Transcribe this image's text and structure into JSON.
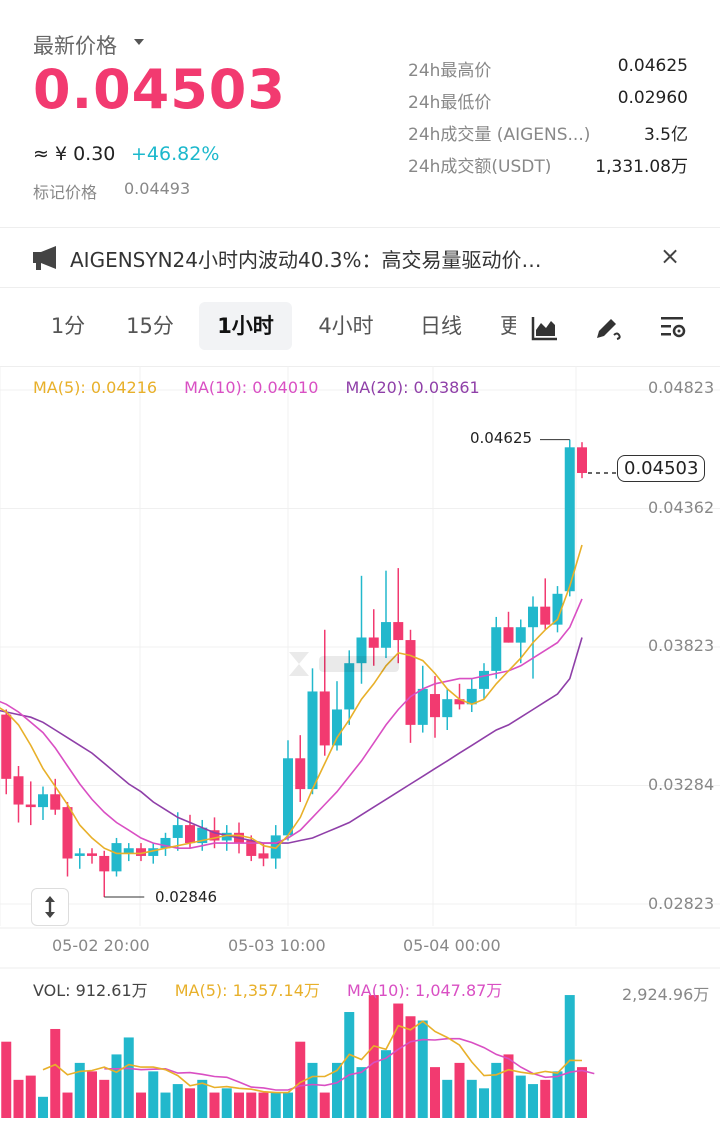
{
  "header": {
    "latest_label": "最新价格",
    "price": "0.04503",
    "cny": "≈ ¥ 0.30",
    "change": "+46.82%",
    "mark_label": "标记价格",
    "mark_value": "0.04493",
    "price_color": "#f23a70",
    "change_color": "#1cb8cc"
  },
  "stats": [
    {
      "label": "24h最高价",
      "value": "0.04625"
    },
    {
      "label": "24h最低价",
      "value": "0.02960"
    },
    {
      "label": "24h成交量 (AIGENS...)",
      "value": "3.5亿"
    },
    {
      "label": "24h成交额(USDT)",
      "value": "1,331.08万"
    }
  ],
  "announcement": {
    "icon": "megaphone-icon",
    "text": "AIGENSYN24小时内波动40.3%：高交易量驱动价…",
    "close": "×"
  },
  "tabs": [
    {
      "label": "1分",
      "active": false
    },
    {
      "label": "15分",
      "active": false
    },
    {
      "label": "1小时",
      "active": true
    },
    {
      "label": "4小时",
      "active": false
    },
    {
      "label": "日线",
      "active": false
    },
    {
      "label": "更",
      "active": false
    }
  ],
  "toolbar_icons": [
    "chart-type-icon",
    "draw-icon",
    "indicator-settings-icon"
  ],
  "chart": {
    "ma_legend": {
      "ma5": "MA(5): 0.04216",
      "ma10": "MA(10): 0.04010",
      "ma20": "MA(20): 0.03861"
    },
    "y_labels": [
      "0.04823",
      "0.04362",
      "0.03823",
      "0.03284",
      "0.02823"
    ],
    "current_price_tag": "0.04503",
    "high_annotation": "0.04625",
    "low_annotation": "0.02846",
    "x_labels": [
      "05-02 20:00",
      "05-03 10:00",
      "05-04 00:00"
    ],
    "vol_legend": {
      "vol": "VOL: 912.61万",
      "ma5": "MA(5): 1,357.14万",
      "ma10": "MA(10): 1,047.87万"
    },
    "vol_max": "2,924.96万",
    "colors": {
      "up": "#22b8cc",
      "down": "#f23a70",
      "ma5": "#e8b02a",
      "ma10": "#d94fc3",
      "ma20": "#8f3fa8"
    }
  },
  "chart_data": {
    "type": "candlestick",
    "interval": "1小时",
    "ylim": [
      0.02823,
      0.04823
    ],
    "candles": [
      {
        "o": 0.0362,
        "h": 0.0368,
        "l": 0.0349,
        "c": 0.0358
      },
      {
        "o": 0.0356,
        "h": 0.0358,
        "l": 0.0325,
        "c": 0.0331
      },
      {
        "o": 0.0332,
        "h": 0.0336,
        "l": 0.0314,
        "c": 0.0321
      },
      {
        "o": 0.0321,
        "h": 0.033,
        "l": 0.0313,
        "c": 0.032
      },
      {
        "o": 0.032,
        "h": 0.0328,
        "l": 0.0315,
        "c": 0.0325
      },
      {
        "o": 0.0325,
        "h": 0.0331,
        "l": 0.0317,
        "c": 0.0319
      },
      {
        "o": 0.032,
        "h": 0.0322,
        "l": 0.0293,
        "c": 0.03
      },
      {
        "o": 0.0301,
        "h": 0.0304,
        "l": 0.0296,
        "c": 0.0302
      },
      {
        "o": 0.0302,
        "h": 0.0304,
        "l": 0.0298,
        "c": 0.0301
      },
      {
        "o": 0.0301,
        "h": 0.0303,
        "l": 0.0285,
        "c": 0.0295
      },
      {
        "o": 0.0295,
        "h": 0.0308,
        "l": 0.0293,
        "c": 0.0306
      },
      {
        "o": 0.0302,
        "h": 0.0306,
        "l": 0.0299,
        "c": 0.0304
      },
      {
        "o": 0.0304,
        "h": 0.0306,
        "l": 0.0299,
        "c": 0.0301
      },
      {
        "o": 0.0301,
        "h": 0.0306,
        "l": 0.0298,
        "c": 0.0304
      },
      {
        "o": 0.0304,
        "h": 0.031,
        "l": 0.0301,
        "c": 0.0308
      },
      {
        "o": 0.0308,
        "h": 0.0318,
        "l": 0.0303,
        "c": 0.0313
      },
      {
        "o": 0.0313,
        "h": 0.0317,
        "l": 0.0304,
        "c": 0.0306
      },
      {
        "o": 0.0306,
        "h": 0.0315,
        "l": 0.0303,
        "c": 0.0312
      },
      {
        "o": 0.0311,
        "h": 0.0316,
        "l": 0.0304,
        "c": 0.0307
      },
      {
        "o": 0.0307,
        "h": 0.0313,
        "l": 0.0303,
        "c": 0.031
      },
      {
        "o": 0.031,
        "h": 0.0314,
        "l": 0.0302,
        "c": 0.0306
      },
      {
        "o": 0.0307,
        "h": 0.0309,
        "l": 0.0299,
        "c": 0.0301
      },
      {
        "o": 0.0302,
        "h": 0.0306,
        "l": 0.0297,
        "c": 0.03
      },
      {
        "o": 0.03,
        "h": 0.0313,
        "l": 0.0296,
        "c": 0.0309
      },
      {
        "o": 0.0309,
        "h": 0.0346,
        "l": 0.0307,
        "c": 0.0339
      },
      {
        "o": 0.0339,
        "h": 0.0348,
        "l": 0.0322,
        "c": 0.0327
      },
      {
        "o": 0.0327,
        "h": 0.0374,
        "l": 0.0325,
        "c": 0.0365
      },
      {
        "o": 0.0365,
        "h": 0.0389,
        "l": 0.034,
        "c": 0.0344
      },
      {
        "o": 0.0344,
        "h": 0.0369,
        "l": 0.0342,
        "c": 0.0358
      },
      {
        "o": 0.0358,
        "h": 0.0381,
        "l": 0.0352,
        "c": 0.0376
      },
      {
        "o": 0.0376,
        "h": 0.041,
        "l": 0.0368,
        "c": 0.0386
      },
      {
        "o": 0.0386,
        "h": 0.0397,
        "l": 0.0375,
        "c": 0.0382
      },
      {
        "o": 0.0382,
        "h": 0.0412,
        "l": 0.0378,
        "c": 0.0392
      },
      {
        "o": 0.0392,
        "h": 0.0413,
        "l": 0.0376,
        "c": 0.0385
      },
      {
        "o": 0.0385,
        "h": 0.0389,
        "l": 0.0345,
        "c": 0.0352
      },
      {
        "o": 0.0352,
        "h": 0.0375,
        "l": 0.0349,
        "c": 0.0366
      },
      {
        "o": 0.0364,
        "h": 0.0371,
        "l": 0.0347,
        "c": 0.0355
      },
      {
        "o": 0.0355,
        "h": 0.0366,
        "l": 0.035,
        "c": 0.0362
      },
      {
        "o": 0.0362,
        "h": 0.0368,
        "l": 0.0358,
        "c": 0.036
      },
      {
        "o": 0.036,
        "h": 0.037,
        "l": 0.0357,
        "c": 0.0366
      },
      {
        "o": 0.0366,
        "h": 0.0376,
        "l": 0.0362,
        "c": 0.0373
      },
      {
        "o": 0.0373,
        "h": 0.0394,
        "l": 0.037,
        "c": 0.039
      },
      {
        "o": 0.039,
        "h": 0.0396,
        "l": 0.0384,
        "c": 0.0384
      },
      {
        "o": 0.0384,
        "h": 0.0393,
        "l": 0.0376,
        "c": 0.039
      },
      {
        "o": 0.039,
        "h": 0.0402,
        "l": 0.037,
        "c": 0.0398
      },
      {
        "o": 0.0398,
        "h": 0.0409,
        "l": 0.0389,
        "c": 0.0391
      },
      {
        "o": 0.0391,
        "h": 0.0406,
        "l": 0.0388,
        "c": 0.0403
      },
      {
        "o": 0.0404,
        "h": 0.0463,
        "l": 0.0402,
        "c": 0.046
      },
      {
        "o": 0.046,
        "h": 0.0462,
        "l": 0.0448,
        "c": 0.045
      }
    ],
    "ma5": [
      0.036,
      0.0357,
      0.0352,
      0.0344,
      0.0335,
      0.0328,
      0.0321,
      0.0313,
      0.0308,
      0.0304,
      0.0302,
      0.0302,
      0.0302,
      0.0303,
      0.0304,
      0.0305,
      0.0306,
      0.0307,
      0.0308,
      0.0309,
      0.0309,
      0.0308,
      0.0305,
      0.0304,
      0.0309,
      0.0316,
      0.0327,
      0.0337,
      0.0347,
      0.0354,
      0.0362,
      0.0368,
      0.0375,
      0.038,
      0.0379,
      0.0377,
      0.0372,
      0.0366,
      0.0362,
      0.036,
      0.0362,
      0.0368,
      0.0373,
      0.0378,
      0.0384,
      0.0389,
      0.0393,
      0.0406,
      0.0422
    ],
    "ma10": [
      0.0362,
      0.036,
      0.0357,
      0.0353,
      0.0349,
      0.0343,
      0.0336,
      0.0329,
      0.0323,
      0.0318,
      0.0314,
      0.0311,
      0.0308,
      0.0306,
      0.0305,
      0.0304,
      0.0304,
      0.0305,
      0.0306,
      0.0306,
      0.0306,
      0.0306,
      0.0306,
      0.0306,
      0.0308,
      0.0311,
      0.0316,
      0.0321,
      0.0326,
      0.0332,
      0.0338,
      0.0345,
      0.0352,
      0.0358,
      0.0363,
      0.0366,
      0.0368,
      0.0369,
      0.037,
      0.037,
      0.0371,
      0.0372,
      0.0373,
      0.0375,
      0.0378,
      0.0381,
      0.0384,
      0.039,
      0.0401
    ],
    "ma20": [
      0.0358,
      0.0357,
      0.0356,
      0.0355,
      0.0353,
      0.035,
      0.0347,
      0.0344,
      0.0341,
      0.0337,
      0.0333,
      0.0329,
      0.0326,
      0.0322,
      0.0319,
      0.0316,
      0.0314,
      0.0312,
      0.031,
      0.0309,
      0.0308,
      0.0307,
      0.0306,
      0.0306,
      0.0306,
      0.0307,
      0.0308,
      0.031,
      0.0312,
      0.0314,
      0.0317,
      0.032,
      0.0323,
      0.0326,
      0.0329,
      0.0332,
      0.0335,
      0.0338,
      0.0341,
      0.0344,
      0.0347,
      0.035,
      0.0352,
      0.0355,
      0.0358,
      0.0361,
      0.0364,
      0.037,
      0.0386
    ],
    "volume_max_wan": 2924.96,
    "volumes_wan": [
      1500,
      1800,
      900,
      1000,
      500,
      2100,
      600,
      1300,
      1100,
      900,
      1500,
      1900,
      600,
      1100,
      600,
      800,
      700,
      900,
      600,
      700,
      600,
      600,
      600,
      600,
      600,
      1800,
      1300,
      600,
      1300,
      2500,
      1200,
      2900,
      1600,
      2700,
      2400,
      2300,
      1200,
      900,
      1300,
      900,
      700,
      1300,
      1500,
      1000,
      800,
      900,
      1100,
      2900,
      1200
    ],
    "vol_ma5_wan": [
      null,
      null,
      null,
      null,
      1140,
      1260,
      1020,
      1100,
      1120,
      1200,
      1080,
      1260,
      1200,
      1200,
      1140,
      1000,
      760,
      820,
      720,
      740,
      700,
      680,
      620,
      600,
      600,
      840,
      980,
      980,
      1120,
      1500,
      1380,
      1700,
      1620,
      2180,
      2080,
      2280,
      2040,
      1900,
      1720,
      1320,
      1000,
      1020,
      1140,
      1080,
      1040,
      1100,
      1060,
      1360,
      1357
    ],
    "vol_ma10_wan": [
      null,
      null,
      null,
      null,
      null,
      null,
      null,
      null,
      null,
      1160,
      1160,
      1170,
      1140,
      1150,
      1160,
      1060,
      1070,
      1030,
      980,
      960,
      850,
      730,
      710,
      660,
      660,
      760,
      790,
      770,
      830,
      1020,
      1080,
      1310,
      1410,
      1620,
      1800,
      1850,
      1840,
      1870,
      1870,
      1780,
      1660,
      1500,
      1400,
      1200,
      1050,
      960,
      980,
      1080,
      1120,
      1048
    ]
  }
}
